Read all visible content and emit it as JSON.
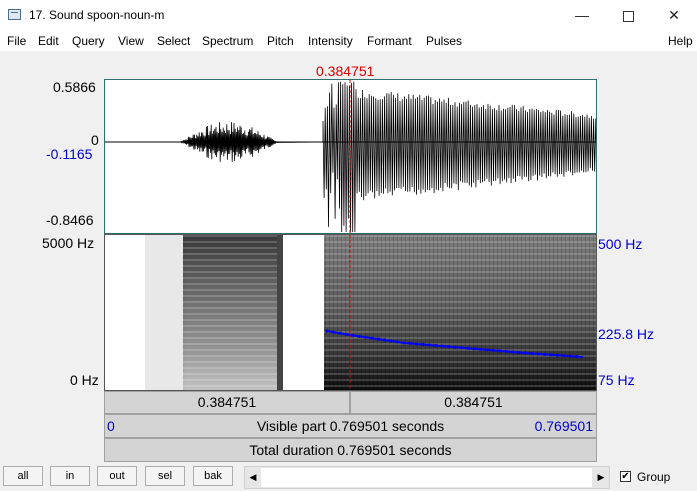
{
  "window": {
    "title": "17. Sound spoon-noun-m",
    "minimize": "—",
    "close": "✕"
  },
  "menu": [
    "File",
    "Edit",
    "Query",
    "View",
    "Select",
    "Spectrum",
    "Pitch",
    "Intensity",
    "Formant",
    "Pulses"
  ],
  "menu_help": "Help",
  "cursor": {
    "time_label": "0.384751"
  },
  "waveform": {
    "ymax": "0.5866",
    "zero": "0",
    "cursor_value": "-0.1165",
    "ymin": "-0.8466"
  },
  "spectrogram": {
    "fmax": "5000 Hz",
    "fmin": "0 Hz"
  },
  "pitch": {
    "top": "500 Hz",
    "cursor_value": "225.8 Hz",
    "bottom": "75 Hz"
  },
  "timebar": {
    "left_seg": "0.384751",
    "right_seg": "0.384751"
  },
  "visible": {
    "start": "0",
    "label": "Visible part 0.769501 seconds",
    "end": "0.769501"
  },
  "total": {
    "label": "Total duration 0.769501 seconds"
  },
  "buttons": [
    "all",
    "in",
    "out",
    "sel",
    "bak"
  ],
  "scroll": {
    "left": "◀",
    "right": "▶"
  },
  "group": {
    "label": "Group",
    "checked": "✔"
  },
  "colors": {
    "pitch_curve": "#0000ee",
    "cursor": "#dd0000",
    "accent_labels": "#0000cc"
  }
}
